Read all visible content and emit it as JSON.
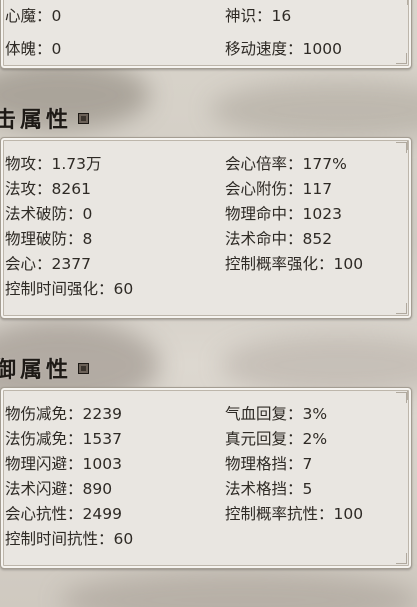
{
  "top_panel": {
    "left": [
      "心魔：0",
      "体魄：0"
    ],
    "right": [
      "神识：16",
      "移动速度：1000"
    ]
  },
  "attack_section": {
    "title": "击属性",
    "left": [
      "物攻：1.73万",
      "法攻：8261",
      "法术破防：0",
      "物理破防：8",
      "会心：2377",
      "控制时间强化：60"
    ],
    "right": [
      "会心倍率：177%",
      "会心附伤：117",
      "物理命中：1023",
      "法术命中：852",
      "控制概率强化：100"
    ]
  },
  "defense_section": {
    "title": "御属性",
    "left": [
      "物伤减免：2239",
      "法伤减免：1537",
      "物理闪避：1003",
      "法术闪避：890",
      "会心抗性：2499",
      "控制时间抗性：60"
    ],
    "right": [
      "气血回复：3%",
      "真元回复：2%",
      "物理格挡：7",
      "法术格挡：5",
      "控制概率抗性：100"
    ]
  },
  "icons": {
    "section_marker": "seal-icon"
  }
}
